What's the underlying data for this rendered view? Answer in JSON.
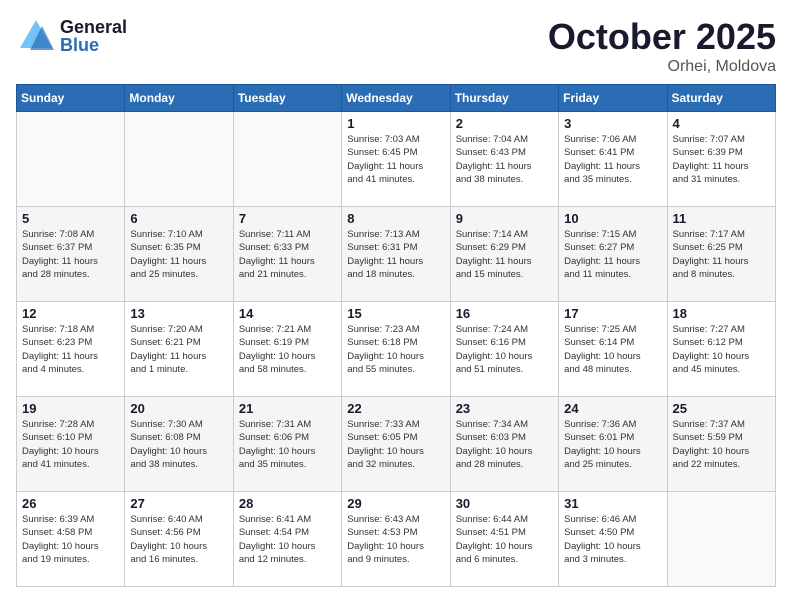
{
  "header": {
    "logo_general": "General",
    "logo_blue": "Blue",
    "month": "October 2025",
    "location": "Orhei, Moldova"
  },
  "weekdays": [
    "Sunday",
    "Monday",
    "Tuesday",
    "Wednesday",
    "Thursday",
    "Friday",
    "Saturday"
  ],
  "weeks": [
    [
      {
        "day": "",
        "info": ""
      },
      {
        "day": "",
        "info": ""
      },
      {
        "day": "",
        "info": ""
      },
      {
        "day": "1",
        "info": "Sunrise: 7:03 AM\nSunset: 6:45 PM\nDaylight: 11 hours\nand 41 minutes."
      },
      {
        "day": "2",
        "info": "Sunrise: 7:04 AM\nSunset: 6:43 PM\nDaylight: 11 hours\nand 38 minutes."
      },
      {
        "day": "3",
        "info": "Sunrise: 7:06 AM\nSunset: 6:41 PM\nDaylight: 11 hours\nand 35 minutes."
      },
      {
        "day": "4",
        "info": "Sunrise: 7:07 AM\nSunset: 6:39 PM\nDaylight: 11 hours\nand 31 minutes."
      }
    ],
    [
      {
        "day": "5",
        "info": "Sunrise: 7:08 AM\nSunset: 6:37 PM\nDaylight: 11 hours\nand 28 minutes."
      },
      {
        "day": "6",
        "info": "Sunrise: 7:10 AM\nSunset: 6:35 PM\nDaylight: 11 hours\nand 25 minutes."
      },
      {
        "day": "7",
        "info": "Sunrise: 7:11 AM\nSunset: 6:33 PM\nDaylight: 11 hours\nand 21 minutes."
      },
      {
        "day": "8",
        "info": "Sunrise: 7:13 AM\nSunset: 6:31 PM\nDaylight: 11 hours\nand 18 minutes."
      },
      {
        "day": "9",
        "info": "Sunrise: 7:14 AM\nSunset: 6:29 PM\nDaylight: 11 hours\nand 15 minutes."
      },
      {
        "day": "10",
        "info": "Sunrise: 7:15 AM\nSunset: 6:27 PM\nDaylight: 11 hours\nand 11 minutes."
      },
      {
        "day": "11",
        "info": "Sunrise: 7:17 AM\nSunset: 6:25 PM\nDaylight: 11 hours\nand 8 minutes."
      }
    ],
    [
      {
        "day": "12",
        "info": "Sunrise: 7:18 AM\nSunset: 6:23 PM\nDaylight: 11 hours\nand 4 minutes."
      },
      {
        "day": "13",
        "info": "Sunrise: 7:20 AM\nSunset: 6:21 PM\nDaylight: 11 hours\nand 1 minute."
      },
      {
        "day": "14",
        "info": "Sunrise: 7:21 AM\nSunset: 6:19 PM\nDaylight: 10 hours\nand 58 minutes."
      },
      {
        "day": "15",
        "info": "Sunrise: 7:23 AM\nSunset: 6:18 PM\nDaylight: 10 hours\nand 55 minutes."
      },
      {
        "day": "16",
        "info": "Sunrise: 7:24 AM\nSunset: 6:16 PM\nDaylight: 10 hours\nand 51 minutes."
      },
      {
        "day": "17",
        "info": "Sunrise: 7:25 AM\nSunset: 6:14 PM\nDaylight: 10 hours\nand 48 minutes."
      },
      {
        "day": "18",
        "info": "Sunrise: 7:27 AM\nSunset: 6:12 PM\nDaylight: 10 hours\nand 45 minutes."
      }
    ],
    [
      {
        "day": "19",
        "info": "Sunrise: 7:28 AM\nSunset: 6:10 PM\nDaylight: 10 hours\nand 41 minutes."
      },
      {
        "day": "20",
        "info": "Sunrise: 7:30 AM\nSunset: 6:08 PM\nDaylight: 10 hours\nand 38 minutes."
      },
      {
        "day": "21",
        "info": "Sunrise: 7:31 AM\nSunset: 6:06 PM\nDaylight: 10 hours\nand 35 minutes."
      },
      {
        "day": "22",
        "info": "Sunrise: 7:33 AM\nSunset: 6:05 PM\nDaylight: 10 hours\nand 32 minutes."
      },
      {
        "day": "23",
        "info": "Sunrise: 7:34 AM\nSunset: 6:03 PM\nDaylight: 10 hours\nand 28 minutes."
      },
      {
        "day": "24",
        "info": "Sunrise: 7:36 AM\nSunset: 6:01 PM\nDaylight: 10 hours\nand 25 minutes."
      },
      {
        "day": "25",
        "info": "Sunrise: 7:37 AM\nSunset: 5:59 PM\nDaylight: 10 hours\nand 22 minutes."
      }
    ],
    [
      {
        "day": "26",
        "info": "Sunrise: 6:39 AM\nSunset: 4:58 PM\nDaylight: 10 hours\nand 19 minutes."
      },
      {
        "day": "27",
        "info": "Sunrise: 6:40 AM\nSunset: 4:56 PM\nDaylight: 10 hours\nand 16 minutes."
      },
      {
        "day": "28",
        "info": "Sunrise: 6:41 AM\nSunset: 4:54 PM\nDaylight: 10 hours\nand 12 minutes."
      },
      {
        "day": "29",
        "info": "Sunrise: 6:43 AM\nSunset: 4:53 PM\nDaylight: 10 hours\nand 9 minutes."
      },
      {
        "day": "30",
        "info": "Sunrise: 6:44 AM\nSunset: 4:51 PM\nDaylight: 10 hours\nand 6 minutes."
      },
      {
        "day": "31",
        "info": "Sunrise: 6:46 AM\nSunset: 4:50 PM\nDaylight: 10 hours\nand 3 minutes."
      },
      {
        "day": "",
        "info": ""
      }
    ]
  ]
}
